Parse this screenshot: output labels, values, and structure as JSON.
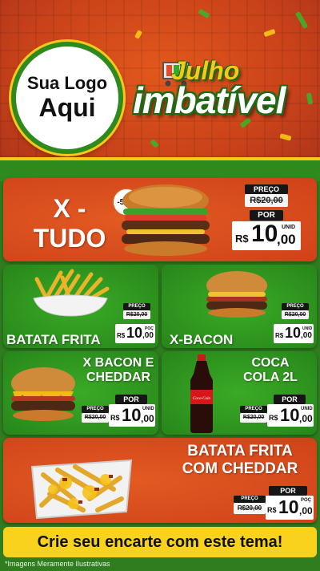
{
  "header": {
    "logo_line1": "Sua Logo",
    "logo_line2": "Aqui",
    "campaign_line1": "Julho",
    "campaign_line2": "imbatível"
  },
  "products": [
    {
      "name_line1": "X -",
      "name_line2": "TUDO",
      "discount_badge": "-50%",
      "price_label": "PREÇO",
      "old_price": "R$20,00",
      "por_label": "POR",
      "currency": "R$",
      "price_int": "10",
      "price_dec": ",00",
      "unit": "UNID"
    },
    {
      "name": "BATATA FRITA",
      "price_label": "PREÇO",
      "old_price": "R$20,00",
      "por_label": "POR",
      "currency": "R$",
      "price_int": "10",
      "price_dec": ",00",
      "unit": "POÇ"
    },
    {
      "name": "X-BACON",
      "price_label": "PREÇO",
      "old_price": "R$20,00",
      "por_label": "POR",
      "currency": "R$",
      "price_int": "10",
      "price_dec": ",00",
      "unit": "UNID"
    },
    {
      "name_line1": "X BACON E",
      "name_line2": "CHEDDAR",
      "price_label": "PREÇO",
      "old_price": "R$20,00",
      "por_label": "POR",
      "currency": "R$",
      "price_int": "10",
      "price_dec": ",00",
      "unit": "UNID"
    },
    {
      "name_line1": "COCA",
      "name_line2": "COLA 2L",
      "bottle_label": "Coca-Cola",
      "price_label": "PREÇO",
      "old_price": "R$20,00",
      "por_label": "POR",
      "currency": "R$",
      "price_int": "10",
      "price_dec": ",00",
      "unit": "UNID"
    },
    {
      "name_line1": "BATATA FRITA",
      "name_line2": "COM CHEDDAR",
      "price_label": "PREÇO",
      "old_price": "R$20,00",
      "por_label": "POR",
      "currency": "R$",
      "price_int": "10",
      "price_dec": ",00",
      "unit": "POÇ"
    }
  ],
  "footer": {
    "cta": "Crie seu encarte com este tema!",
    "disclaimer": "*Imagens Meramente Ilustrativas"
  },
  "colors": {
    "orange_card": "#d94b1c",
    "green_card": "#2f9a1f",
    "yellow": "#f8d21c",
    "dark_tag": "#161616"
  }
}
